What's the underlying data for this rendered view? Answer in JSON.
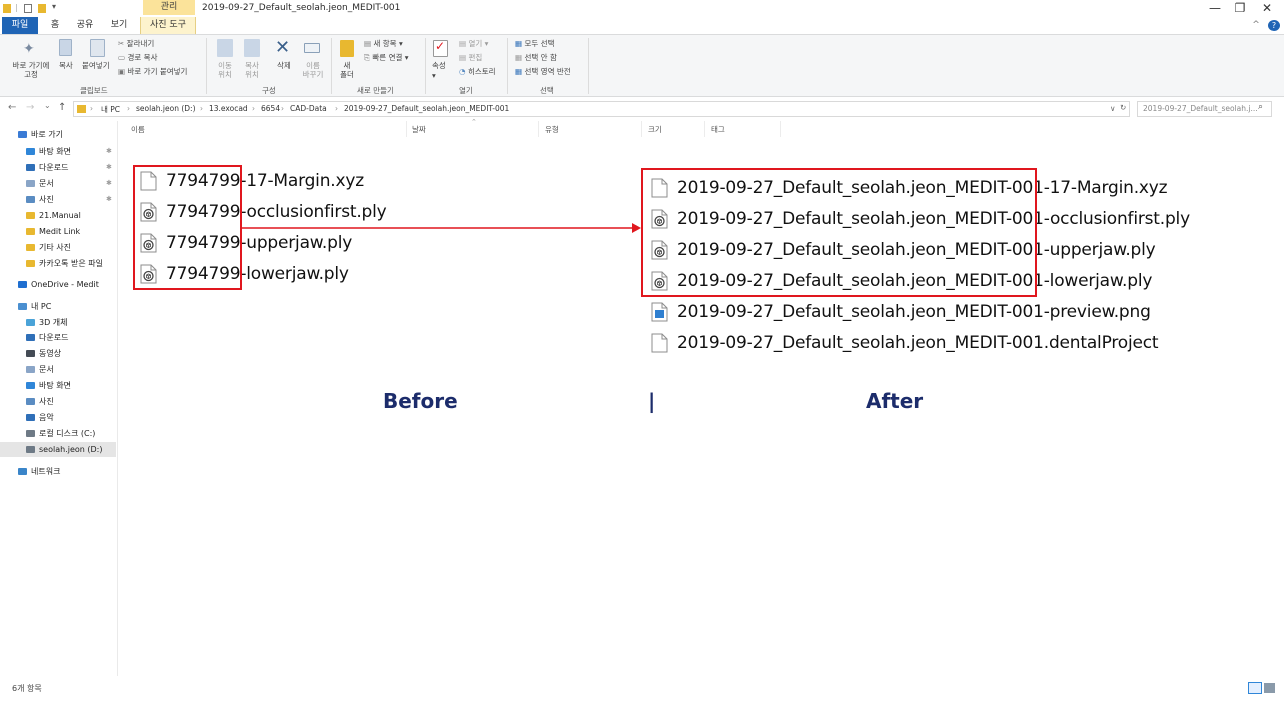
{
  "window": {
    "title": "2019-09-27_Default_seolah.jeon_MEDIT-001",
    "context_group_label": "관리",
    "minimize": "—",
    "maximize": "❐",
    "close": "✕"
  },
  "tabs": {
    "file": "파일",
    "home": "홈",
    "share": "공유",
    "view": "보기",
    "context": "사진 도구",
    "help_chevron": "^",
    "help_icon": "?"
  },
  "ribbon": {
    "clipboard": {
      "pin_quick": "바로 가기에\n고정",
      "copy": "복사",
      "paste": "붙여넣기",
      "cut": "잘라내기",
      "copy_path": "경로 복사",
      "paste_shortcut": "바로 가기 붙여넣기",
      "group": "클립보드"
    },
    "organize": {
      "move_to": "이동\n위치",
      "copy_to": "복사\n위치",
      "delete": "삭제",
      "rename": "이름\n바꾸기",
      "group": "구성"
    },
    "new": {
      "new_folder": "새\n폴더",
      "new_item": "새 항목",
      "easy_access": "빠른 연결",
      "group": "새로 만들기"
    },
    "open": {
      "properties": "속성",
      "open": "열기",
      "edit": "편집",
      "history": "히스토리",
      "group": "열기"
    },
    "select": {
      "select_all": "모두 선택",
      "select_none": "선택 안 함",
      "invert": "선택 영역 반전",
      "group": "선택"
    }
  },
  "address": {
    "back": "←",
    "forward": "→",
    "recent": "⌄",
    "up": "↑",
    "crumbs": [
      "내 PC",
      "seolah.jeon (D:)",
      "13.exocad",
      "6654",
      "CAD-Data",
      "2019-09-27_Default_seolah.jeon_MEDIT-001"
    ],
    "separator": "›",
    "search_placeholder": "2019-09-27_Default_seolah.j...",
    "dropdown": "∨",
    "refresh": "↻"
  },
  "nav": {
    "items": [
      {
        "label": "바로 가기",
        "icon": "star-icon",
        "color": "#3a7bd5",
        "indent": 0,
        "pin": false
      },
      {
        "label": "바탕 화면",
        "icon": "desktop-icon",
        "color": "#2f86d8",
        "indent": 1,
        "pin": true
      },
      {
        "label": "다운로드",
        "icon": "download-icon",
        "color": "#2f6fb8",
        "indent": 1,
        "pin": true
      },
      {
        "label": "문서",
        "icon": "document-icon",
        "color": "#8aa5c7",
        "indent": 1,
        "pin": true
      },
      {
        "label": "사진",
        "icon": "picture-icon",
        "color": "#5a8cc2",
        "indent": 1,
        "pin": true
      },
      {
        "label": "21.Manual",
        "icon": "folder-icon",
        "color": "#e8b830",
        "indent": 1,
        "pin": false
      },
      {
        "label": "Medit Link",
        "icon": "folder-icon",
        "color": "#e8b830",
        "indent": 1,
        "pin": false
      },
      {
        "label": "기타 사진",
        "icon": "folder-icon",
        "color": "#e8b830",
        "indent": 1,
        "pin": false
      },
      {
        "label": "카카오톡 받은 파일",
        "icon": "folder-icon",
        "color": "#e8b830",
        "indent": 1,
        "pin": false
      },
      {
        "label": "OneDrive - Medit",
        "icon": "cloud-icon",
        "color": "#1f6fd0",
        "indent": 0,
        "pin": false
      },
      {
        "label": "내 PC",
        "icon": "computer-icon",
        "color": "#4a8fd0",
        "indent": 0,
        "pin": false
      },
      {
        "label": "3D 개체",
        "icon": "cube-icon",
        "color": "#4aa3d8",
        "indent": 1,
        "pin": false
      },
      {
        "label": "다운로드",
        "icon": "download-icon",
        "color": "#2f6fb8",
        "indent": 1,
        "pin": false
      },
      {
        "label": "동영상",
        "icon": "video-icon",
        "color": "#444b55",
        "indent": 1,
        "pin": false
      },
      {
        "label": "문서",
        "icon": "document-icon",
        "color": "#8aa5c7",
        "indent": 1,
        "pin": false
      },
      {
        "label": "바탕 화면",
        "icon": "desktop-icon",
        "color": "#2f86d8",
        "indent": 1,
        "pin": false
      },
      {
        "label": "사진",
        "icon": "picture-icon",
        "color": "#5a8cc2",
        "indent": 1,
        "pin": false
      },
      {
        "label": "음악",
        "icon": "music-icon",
        "color": "#2f6fb8",
        "indent": 1,
        "pin": false
      },
      {
        "label": "로컬 디스크 (C:)",
        "icon": "drive-icon",
        "color": "#6e7a86",
        "indent": 1,
        "pin": false
      },
      {
        "label": "seolah.jeon (D:)",
        "icon": "drive-icon",
        "color": "#6e7a86",
        "indent": 1,
        "pin": false,
        "selected": true
      },
      {
        "label": "네트워크",
        "icon": "network-icon",
        "color": "#3a85c9",
        "indent": 0,
        "pin": false
      }
    ]
  },
  "columns": [
    "이름",
    "날짜",
    "유형",
    "크기",
    "태그"
  ],
  "before": {
    "caption": "Before",
    "prefix": "7794799",
    "files": [
      {
        "suffix": "-17-Margin.xyz",
        "icon": "blank-file-icon"
      },
      {
        "suffix": "-occlusionfirst.ply",
        "icon": "3d-model-file-icon"
      },
      {
        "suffix": "-upperjaw.ply",
        "icon": "3d-model-file-icon"
      },
      {
        "suffix": "-lowerjaw.ply",
        "icon": "3d-model-file-icon"
      }
    ]
  },
  "after": {
    "caption": "After",
    "prefix": "2019-09-27_Default_seolah.jeon_MEDIT-001",
    "files": [
      {
        "suffix": "-17-Margin.xyz",
        "icon": "blank-file-icon"
      },
      {
        "suffix": "-occlusionfirst.ply",
        "icon": "3d-model-file-icon"
      },
      {
        "suffix": "-upperjaw.ply",
        "icon": "3d-model-file-icon"
      },
      {
        "suffix": "-lowerjaw.ply",
        "icon": "3d-model-file-icon"
      },
      {
        "suffix": "-preview.png",
        "icon": "image-file-icon"
      },
      {
        "suffix": ".dentalProject",
        "icon": "blank-file-icon"
      }
    ]
  },
  "divider": "|",
  "status": {
    "item_count": "6개 항목"
  },
  "colors": {
    "accent_blue": "#1f64b5",
    "highlight_red": "#e0171e",
    "caption_navy": "#1c2c6b",
    "context_tab_yellow": "#fbe39a"
  }
}
